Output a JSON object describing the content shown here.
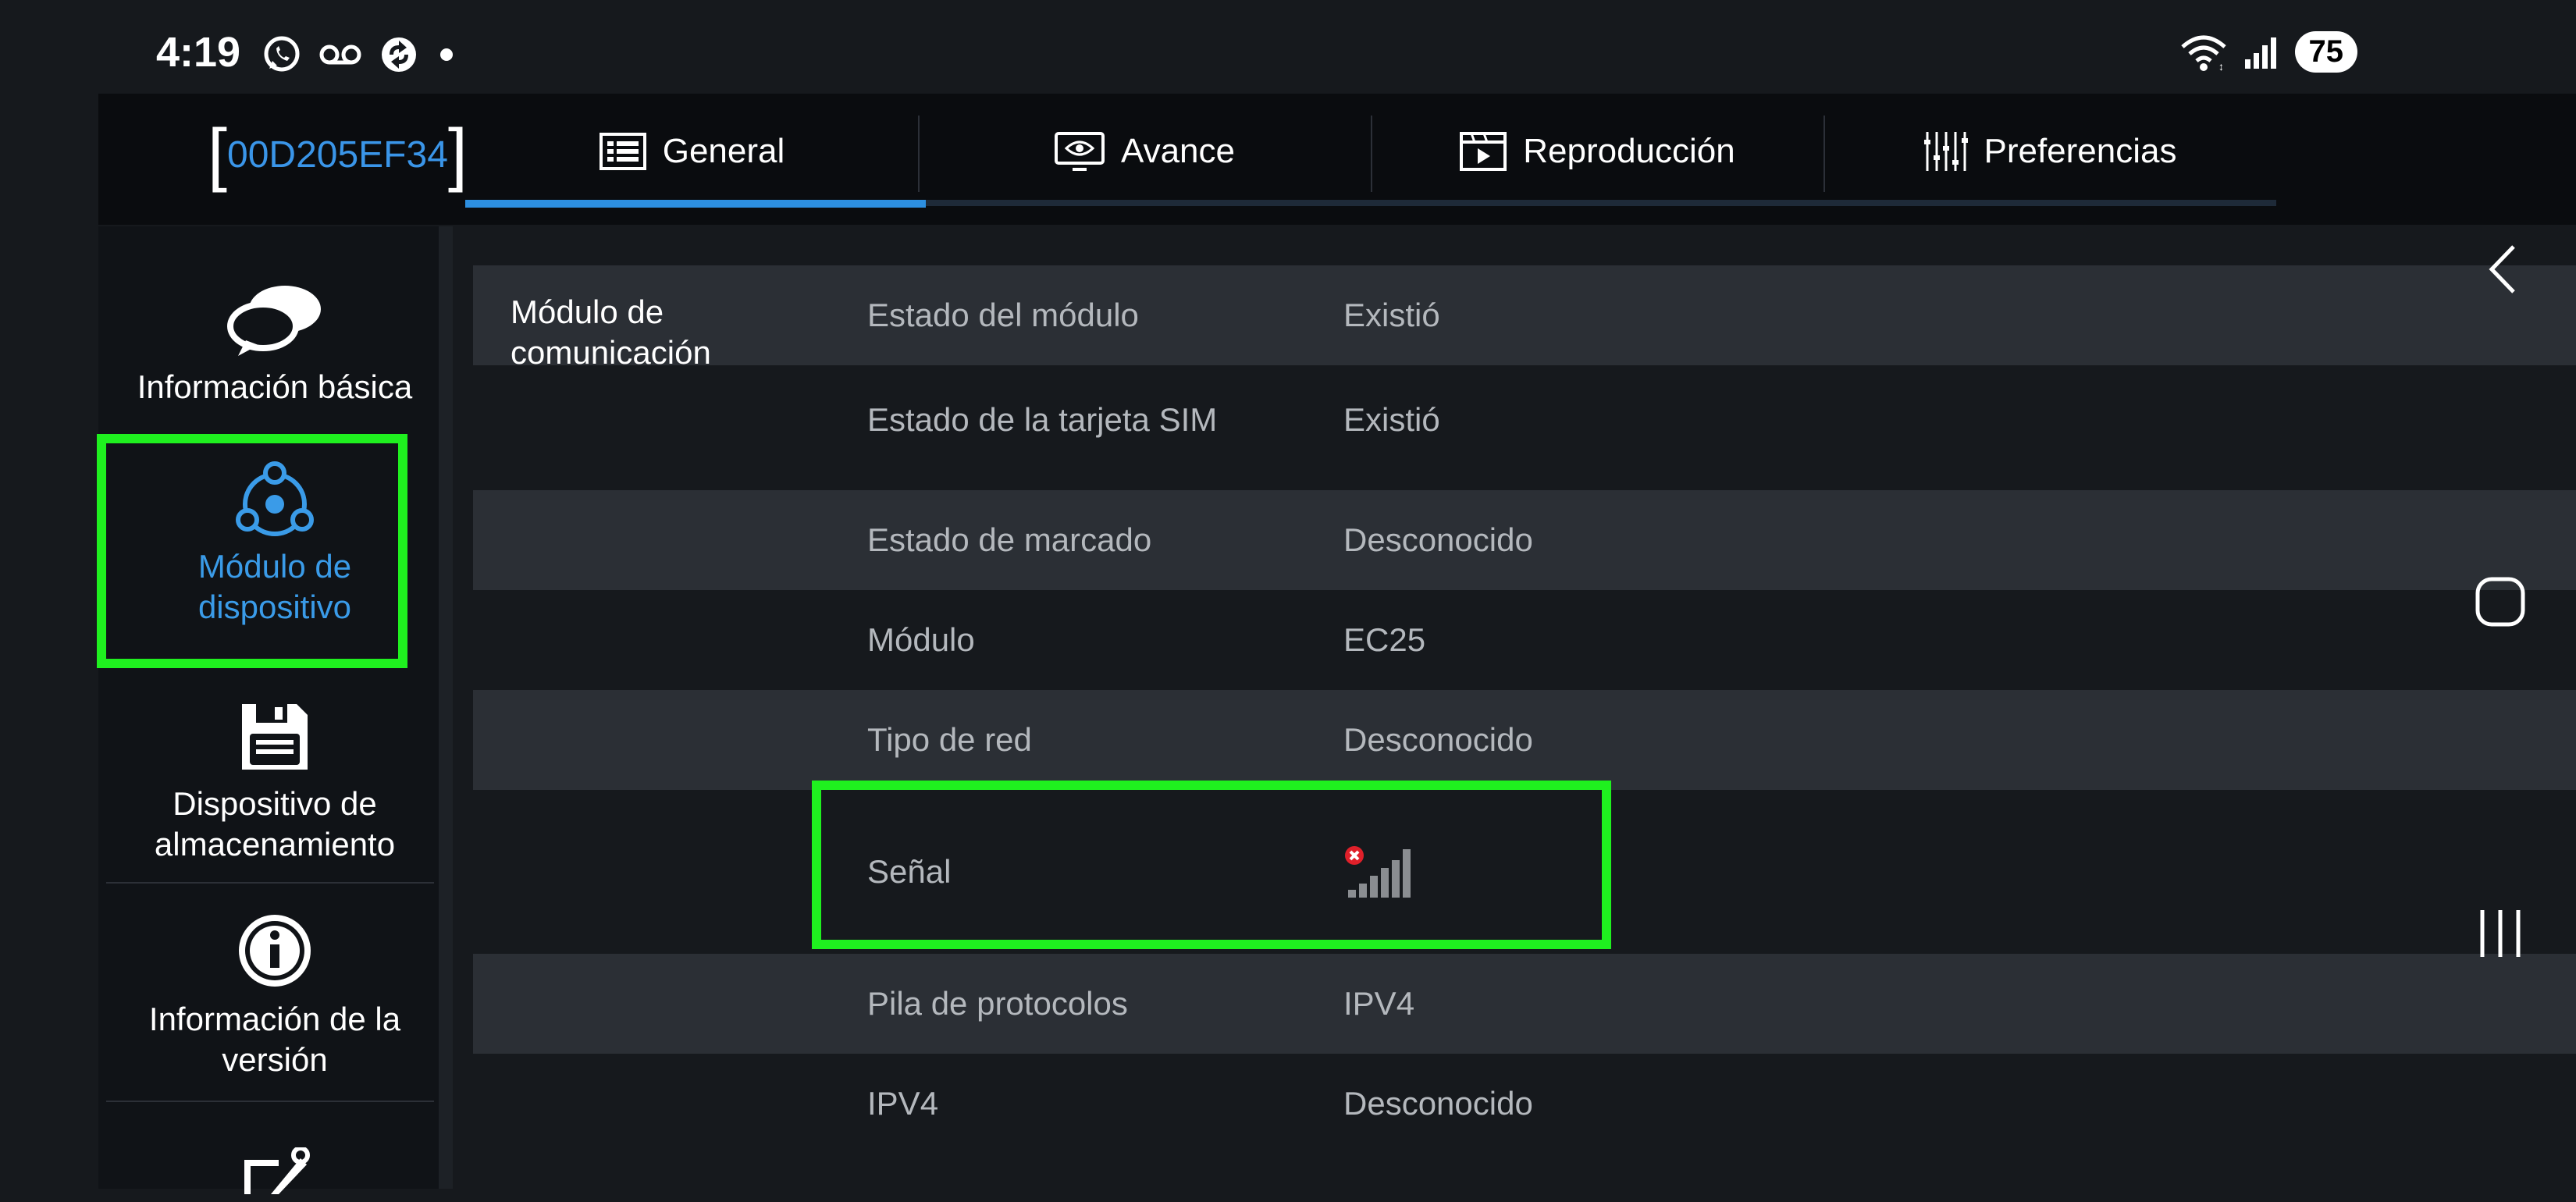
{
  "status_bar": {
    "time": "4:19",
    "icons": [
      "whatsapp-icon",
      "voicemail-icon",
      "sync-app-icon",
      "notification-dot"
    ],
    "right_icons": [
      "wifi-icon",
      "cell-signal-icon"
    ],
    "battery": "75"
  },
  "header": {
    "device_id": "00D205EF34",
    "tabs": [
      {
        "label": "General",
        "icon": "list-icon",
        "active": true
      },
      {
        "label": "Avance",
        "icon": "monitor-eye-icon",
        "active": false
      },
      {
        "label": "Reproducción",
        "icon": "video-clip-icon",
        "active": false
      },
      {
        "label": "Preferencias",
        "icon": "sliders-icon",
        "active": false
      }
    ],
    "more_icon": "kebab-menu-icon"
  },
  "sidebar": {
    "items": [
      {
        "label": "Información básica",
        "icon": "chat-bubbles-icon",
        "active": false
      },
      {
        "label_line1": "Módulo de",
        "label_line2": "dispositivo",
        "icon": "network-nodes-icon",
        "active": true
      },
      {
        "label_line1": "Dispositivo de",
        "label_line2": "almacenamiento",
        "icon": "floppy-disk-icon",
        "active": false
      },
      {
        "label_line1": "Información de la",
        "label_line2": "versión",
        "icon": "info-icon",
        "active": false
      },
      {
        "icon": "tools-icon"
      }
    ]
  },
  "content": {
    "section_line1": "Módulo de",
    "section_line2": "comunicación",
    "rows": [
      {
        "name": "Estado del módulo",
        "value": "Existió"
      },
      {
        "name": "Estado de la tarjeta SIM",
        "value": "Existió"
      },
      {
        "name": "Estado de marcado",
        "value": "Desconocido"
      },
      {
        "name": "Módulo",
        "value": "EC25"
      },
      {
        "name": "Tipo de red",
        "value": "Desconocido"
      },
      {
        "name": "Señal",
        "value_icon": "signal-bars-error-icon"
      },
      {
        "name": "Pila de protocolos",
        "value": "IPV4"
      },
      {
        "name": "IPV4",
        "value": "Desconocido"
      }
    ]
  },
  "system_nav": [
    "back-icon",
    "home-icon",
    "recents-icon"
  ],
  "colors": {
    "accent": "#2d8fe0",
    "highlight": "#1ff01f",
    "row_alt": "#2b2f35",
    "background": "#16191d"
  }
}
